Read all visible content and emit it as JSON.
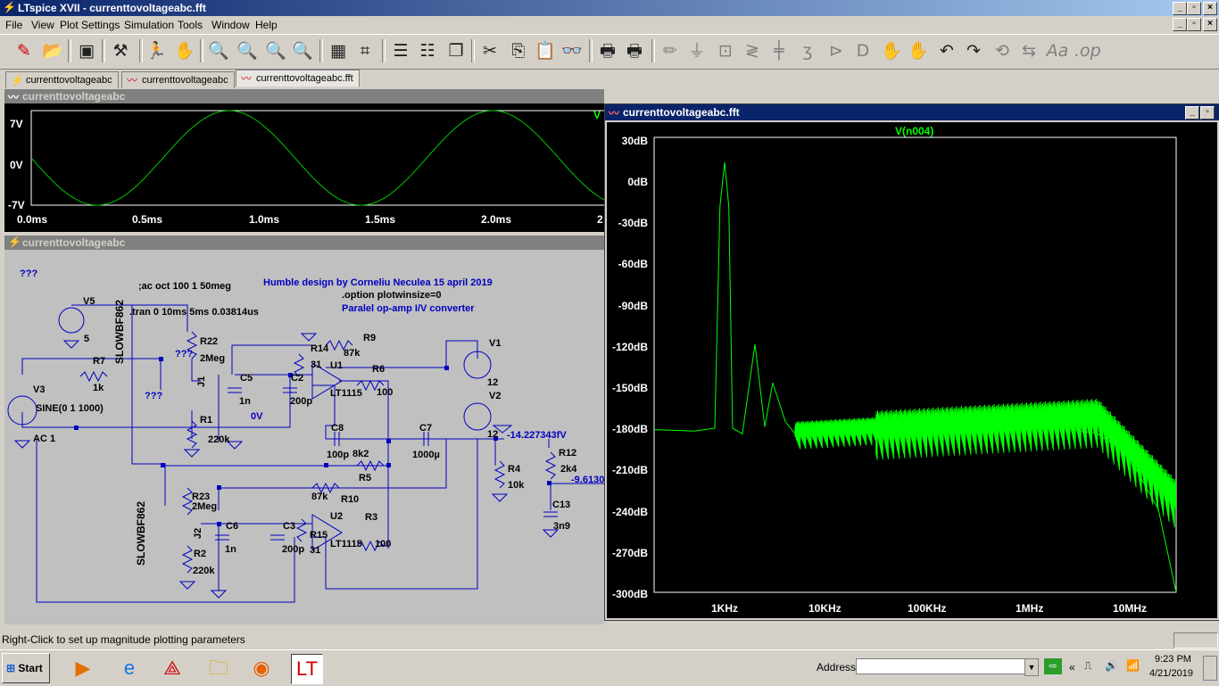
{
  "window": {
    "title": "LTspice XVII - currenttovoltageabc.fft"
  },
  "menu": [
    "File",
    "View",
    "Plot Settings",
    "Simulation",
    "Tools",
    "Window",
    "Help"
  ],
  "tabs": [
    "currenttovoltageabc",
    "currenttovoltageabc",
    "currenttovoltageabc.fft"
  ],
  "time_plot": {
    "title": "currenttovoltageabc",
    "trace_label": "V",
    "y_ticks": [
      "7V",
      "0V",
      "-7V"
    ],
    "x_ticks": [
      "0.0ms",
      "0.5ms",
      "1.0ms",
      "1.5ms",
      "2.0ms",
      "2"
    ],
    "trace_color": "#00c800"
  },
  "schematic": {
    "title": "currenttovoltageabc",
    "texts": {
      "directive_ac": ";ac oct 100 1 50meg",
      "directive_tran": ".tran 0 10ms 5ms 0.03814us",
      "credit": "Humble design by Corneliu Neculea 15 april 2019",
      "option": ".option plotwinsize=0",
      "desc": "Paralel op-amp I/V converter",
      "q1": "???",
      "q2": "???",
      "q3": "???",
      "v5": "V5",
      "v5val": "5",
      "v3": "V3",
      "v3val": "SINE(0 1 1000)",
      "ac": "AC 1",
      "r7": "R7",
      "r7val": "1k",
      "jfet1": "SLOWBF862",
      "jfet2": "SLOWBF862",
      "j1": "J1",
      "j2": "J2",
      "r22": "R22",
      "r22val": "2Meg",
      "r1": "R1",
      "r1val": "220k",
      "c5": "C5",
      "c5val": "1n",
      "c2": "C2",
      "c2val": "200p",
      "r14": "R14",
      "r14val": "31",
      "r9": "R9",
      "r9val": "87k",
      "u1": "U1",
      "u1val": "LT1115",
      "r6": "R6",
      "r6val": "100",
      "v1": "V1",
      "v1val": "12",
      "v2": "V2",
      "v2val": "12",
      "node0v": "0V",
      "c8": "C8",
      "c8val": "100p",
      "c7": "C7",
      "c7val": "1000µ",
      "r8val": "8k2",
      "r5": "R5",
      "vout": "-14.227343fV",
      "r12": "R12",
      "r12val": "2k4",
      "r4": "R4",
      "r4val": "10k",
      "vout2": "-9.6130",
      "c13": "C13",
      "c13val": "3n9",
      "r10": "R10",
      "r10val": "87k",
      "r23": "R23",
      "r23val": "2Meg",
      "c6": "C6",
      "c6val": "1n",
      "c3": "C3",
      "c3val": "200p",
      "r15": "R15",
      "r15val": "31",
      "u2": "U2",
      "u2val": "LT1115",
      "r3": "R3",
      "r3val": "100",
      "r2": "R2",
      "r2val": "220k"
    }
  },
  "fft_plot": {
    "title": "currenttovoltageabc.fft",
    "trace_label": "V(n004)",
    "y_ticks": [
      "30dB",
      "0dB",
      "-30dB",
      "-60dB",
      "-90dB",
      "-120dB",
      "-150dB",
      "-180dB",
      "-210dB",
      "-240dB",
      "-270dB",
      "-300dB"
    ],
    "x_ticks": [
      "1KHz",
      "10KHz",
      "100KHz",
      "1MHz",
      "10MHz"
    ],
    "trace_color": "#00ff00"
  },
  "chart_data": [
    {
      "type": "line",
      "title": "",
      "xlabel": "",
      "ylabel": "",
      "series": [
        {
          "name": "V",
          "x": [
            0,
            0.25,
            0.5,
            0.75,
            1.0,
            1.25,
            1.5,
            1.75,
            2.0
          ],
          "values": [
            0,
            -7,
            0,
            7,
            0,
            -7,
            0,
            7,
            0
          ]
        }
      ],
      "x_unit": "ms",
      "xlim": [
        0,
        2.2
      ],
      "ylim": [
        -7,
        7
      ],
      "x_ticks": [
        "0.0ms",
        "0.5ms",
        "1.0ms",
        "1.5ms",
        "2.0ms"
      ],
      "y_ticks": [
        "7V",
        "0V",
        "-7V"
      ],
      "grid": false
    },
    {
      "type": "line",
      "title": "",
      "xlabel": "",
      "ylabel": "",
      "series": [
        {
          "name": "V(n004)",
          "x": [
            200,
            500,
            800,
            900,
            1000,
            1100,
            1200,
            1500,
            2000,
            2500,
            3000,
            4000,
            5000,
            10000,
            20000,
            50000,
            100000,
            200000,
            500000,
            1000000,
            2000000,
            5000000,
            10000000,
            20000000,
            30000000
          ],
          "values": [
            -182,
            -183,
            -181,
            -20,
            12,
            -20,
            -181,
            -185,
            -120,
            -180,
            -148,
            -176,
            -185,
            -184,
            -186,
            -182,
            -180,
            -179,
            -178,
            -180,
            -180,
            -185,
            -200,
            -240,
            -300
          ]
        }
      ],
      "x_scale": "log",
      "xlim": [
        200,
        30000000
      ],
      "ylim": [
        -300,
        30
      ],
      "x_ticks": [
        "1KHz",
        "10KHz",
        "100KHz",
        "1MHz",
        "10MHz"
      ],
      "y_ticks": [
        "30dB",
        "0dB",
        "-30dB",
        "-60dB",
        "-90dB",
        "-120dB",
        "-150dB",
        "-180dB",
        "-210dB",
        "-240dB",
        "-270dB",
        "-300dB"
      ],
      "grid": false
    }
  ],
  "status": {
    "text": "Right-Click to set up magnitude plotting parameters"
  },
  "taskbar": {
    "start": "Start",
    "address_label": "Address",
    "address_value": "",
    "time": "9:23 PM",
    "date": "4/21/2019"
  }
}
